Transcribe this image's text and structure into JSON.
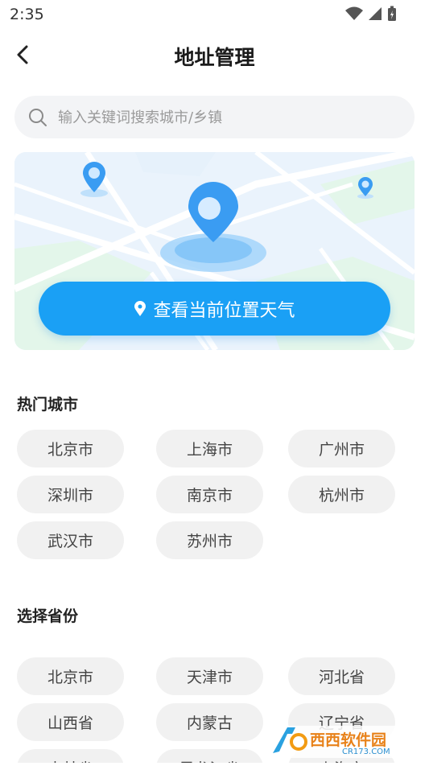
{
  "status": {
    "time": "2:35"
  },
  "header": {
    "title": "地址管理"
  },
  "search": {
    "placeholder": "输入关键词搜索城市/乡镇",
    "value": ""
  },
  "locate": {
    "label": "查看当前位置天气"
  },
  "hot": {
    "title": "热门城市",
    "items": [
      "北京市",
      "上海市",
      "广州市",
      "深圳市",
      "南京市",
      "杭州市",
      "武汉市",
      "苏州市"
    ]
  },
  "provinces": {
    "title": "选择省份",
    "items": [
      "北京市",
      "天津市",
      "河北省",
      "山西省",
      "内蒙古",
      "辽宁省",
      "吉林省",
      "黑龙江省",
      "上海市"
    ]
  },
  "watermark": {
    "text": "西西软件园",
    "sub": "CR173.COM"
  },
  "colors": {
    "accent": "#1aa0f5",
    "chip_bg": "#f1f1f1",
    "search_bg": "#f3f4f6"
  }
}
